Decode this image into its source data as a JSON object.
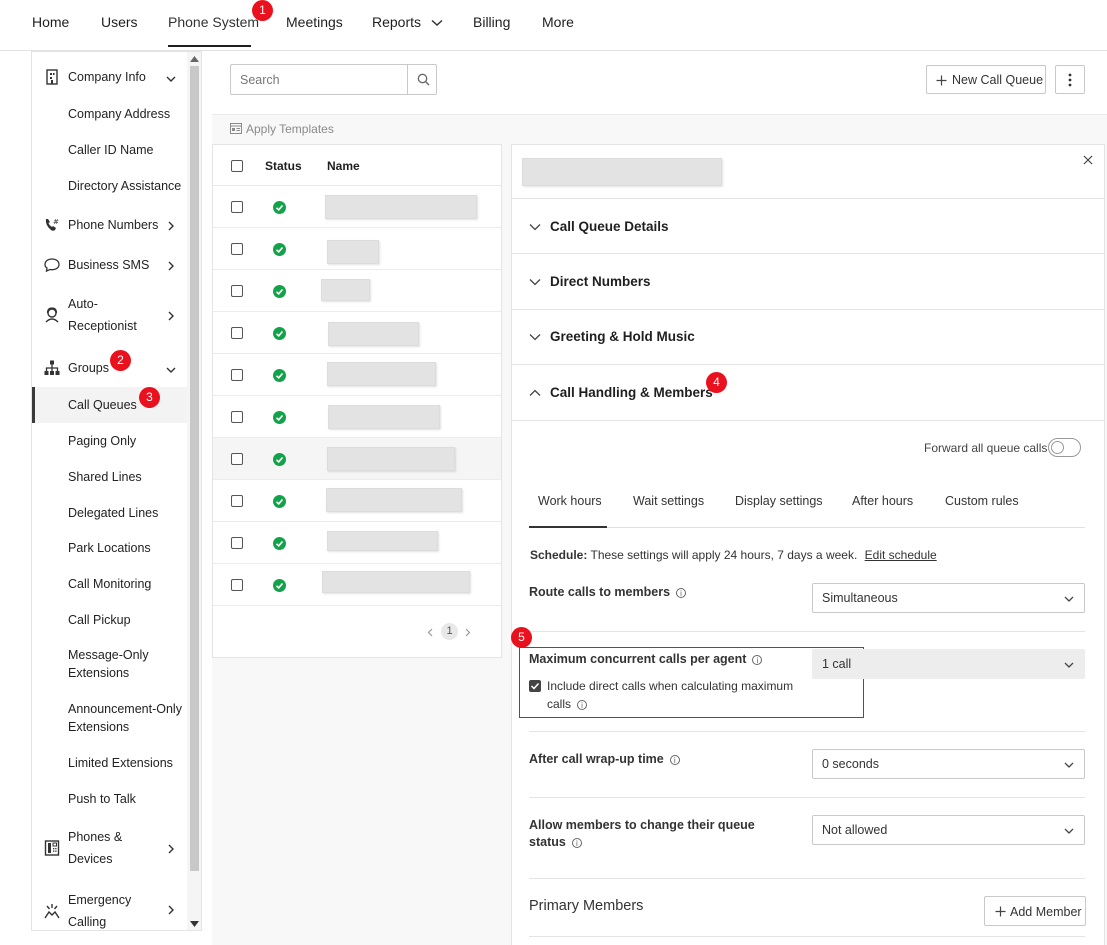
{
  "topnav": {
    "tabs": [
      {
        "label": "Home"
      },
      {
        "label": "Users"
      },
      {
        "label": "Phone System"
      },
      {
        "label": "Meetings"
      },
      {
        "label": "Reports"
      },
      {
        "label": "Billing"
      },
      {
        "label": "More"
      }
    ],
    "active_tab": "Phone System"
  },
  "annotations": {
    "b1": "1",
    "b2": "2",
    "b3": "3",
    "b4": "4",
    "b5": "5"
  },
  "sidebar": {
    "company_info": "Company Info",
    "company_address": "Company Address",
    "caller_id": "Caller ID Name",
    "directory": "Directory Assistance",
    "phone_numbers": "Phone Numbers",
    "business_sms": "Business SMS",
    "auto_rec_1": "Auto-",
    "auto_rec_2": "Receptionist",
    "groups": "Groups",
    "call_queues": "Call Queues",
    "paging_only": "Paging Only",
    "shared_lines": "Shared Lines",
    "delegated_lines": "Delegated Lines",
    "park_locations": "Park Locations",
    "call_monitoring": "Call Monitoring",
    "call_pickup": "Call Pickup",
    "message_only_1": "Message-Only",
    "message_only_2": "Extensions",
    "announcement_1": "Announcement-Only",
    "announcement_2": "Extensions",
    "limited_ext": "Limited Extensions",
    "push_to_talk": "Push to Talk",
    "phones_1": "Phones &",
    "phones_2": "Devices",
    "emergency_1": "Emergency",
    "emergency_2": "Calling"
  },
  "toolbar": {
    "search_placeholder": "Search",
    "new_queue": "New Call Queue",
    "apply_templates": "Apply Templates"
  },
  "list": {
    "col_status": "Status",
    "col_name": "Name",
    "row_count": 10,
    "page": "1"
  },
  "detail": {
    "sections": {
      "details": "Call Queue Details",
      "direct": "Direct Numbers",
      "greeting": "Greeting & Hold Music",
      "handling": "Call Handling & Members"
    },
    "forward_all": "Forward all queue calls",
    "tabs": {
      "work_hours": "Work hours",
      "wait": "Wait settings",
      "display": "Display settings",
      "after": "After hours",
      "custom": "Custom rules"
    },
    "schedule_label": "Schedule:",
    "schedule_text": "These settings will apply 24 hours, 7 days a week.",
    "edit_schedule": "Edit schedule",
    "route_label": "Route calls to members",
    "route_value": "Simultaneous",
    "max_label": "Maximum concurrent calls per agent",
    "max_value": "1 call",
    "include_1": "Include direct calls when calculating maximum",
    "include_2": "calls",
    "wrapup_label": "After call wrap-up time",
    "wrapup_value": "0 seconds",
    "allow_1": "Allow members to change their queue",
    "allow_2": "status",
    "allow_value": "Not allowed",
    "primary_members": "Primary Members",
    "add_member": "Add Member"
  },
  "colors": {
    "badge": "#e8111d",
    "status_ok": "#12a34a",
    "highlight_box": "#e8111d"
  }
}
